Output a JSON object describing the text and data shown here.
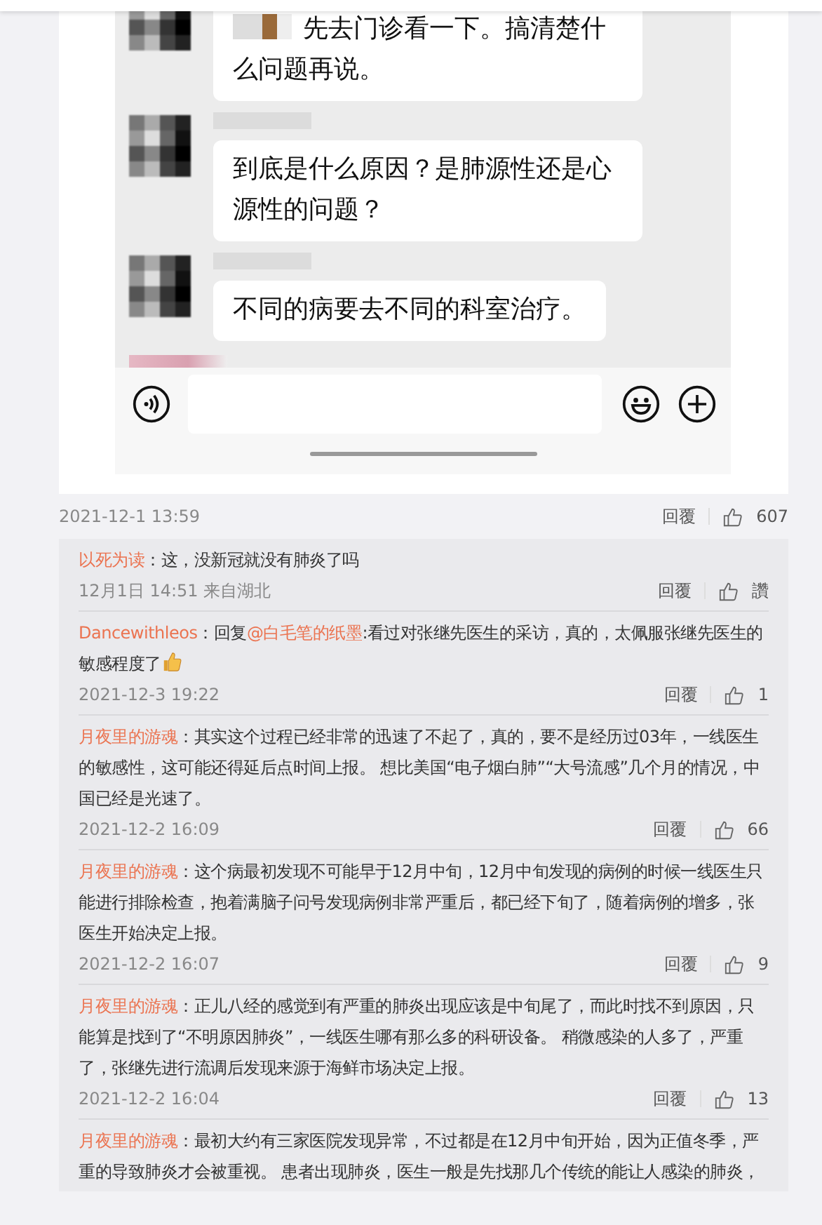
{
  "chat_screenshot": {
    "messages": [
      {
        "text": "先去门诊看一下。搞清楚什么问题再说。",
        "blurred_prefix": true,
        "avatar_cut": true
      },
      {
        "text": "到底是什么原因？是肺源性还是心源性的问题？",
        "blurred_prefix": false,
        "avatar_cut": false
      },
      {
        "text": "不同的病要去不同的科室治疗。",
        "blurred_prefix": false,
        "avatar_cut": false
      }
    ]
  },
  "post_meta": {
    "time": "2021-12-1 13:59",
    "reply": "回覆",
    "likes": "607"
  },
  "comments": [
    {
      "author": "以死为读",
      "text": "：这，没新冠就没有肺炎了吗",
      "time": "12月1日 14:51 来自湖北",
      "reply": "回覆",
      "likes": "讚",
      "emoji": false
    },
    {
      "author": "Dancewithleos",
      "reply_prefix": "：回复",
      "mention": "@白毛笔的纸墨",
      "text": ":看过对张继先医生的采访，真的，太佩服张继先医生的敏感程度了",
      "time": "2021-12-3 19:22",
      "reply": "回覆",
      "likes": "1",
      "emoji": true
    },
    {
      "author": "月夜里的游魂",
      "text": "：其实这个过程已经非常的迅速了不起了，真的，要不是经历过03年，一线医生的敏感性，这可能还得延后点时间上报。 想比美国“电子烟白肺”“大号流感”几个月的情况，中国已经是光速了。",
      "time": "2021-12-2 16:09",
      "reply": "回覆",
      "likes": "66",
      "emoji": false
    },
    {
      "author": "月夜里的游魂",
      "text": "：这个病最初发现不可能早于12月中旬，12月中旬发现的病例的时候一线医生只能进行排除检查，抱着满脑子问号发现病例非常严重后，都已经下旬了，随着病例的增多，张医生开始决定上报。",
      "time": "2021-12-2 16:07",
      "reply": "回覆",
      "likes": "9",
      "emoji": false
    },
    {
      "author": "月夜里的游魂",
      "text": "：正儿八经的感觉到有严重的肺炎出现应该是中旬尾了，而此时找不到原因，只能算是找到了“不明原因肺炎”，一线医生哪有那么多的科研设备。 稍微感染的人多了，严重了，张继先进行流调后发现来源于海鲜市场决定上报。",
      "time": "2021-12-2 16:04",
      "reply": "回覆",
      "likes": "13",
      "emoji": false
    },
    {
      "author": "月夜里的游魂",
      "text": "：最初大约有三家医院发现异常，不过都是在12月中旬开始，因为正值冬季，严重的导致肺炎才会被重视。 患者出现肺炎，医生一般是先找那几个传统的能让人感染的肺炎，",
      "emoji": false
    }
  ]
}
